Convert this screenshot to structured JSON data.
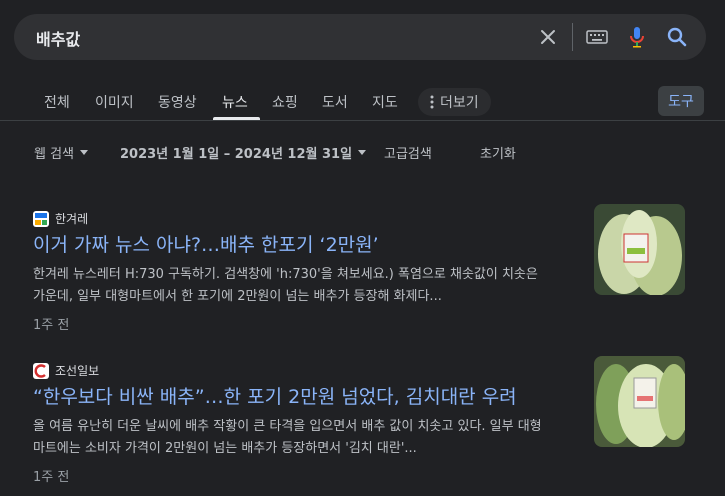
{
  "search": {
    "query": "배추값"
  },
  "icons": {
    "clear": "close-icon",
    "keyboard": "keyboard-icon",
    "mic": "mic-icon",
    "search": "search-icon"
  },
  "tabs": [
    {
      "label": "전체"
    },
    {
      "label": "이미지"
    },
    {
      "label": "동영상"
    },
    {
      "label": "뉴스",
      "active": true
    },
    {
      "label": "쇼핑"
    },
    {
      "label": "도서"
    },
    {
      "label": "지도"
    }
  ],
  "more_tab": {
    "label": "더보기"
  },
  "tools": {
    "label": "도구"
  },
  "filters": {
    "web_search": "웹 검색",
    "date_range": "2023년 1월 1일 – 2024년 12월 31일",
    "advanced": "고급검색",
    "reset": "초기화"
  },
  "results": [
    {
      "source": "한겨레",
      "title": "이거 가짜 뉴스 아냐?…배추 한포기 ‘2만원’",
      "snippet": "한겨레 뉴스레터 H:730 구독하기. 검색창에 'h:730'을 쳐보세요.) 폭염으로 채솟값이 치솟은 가운데, 일부 대형마트에서 한 포기에 2만원이 넘는 배추가 등장해 화제다...",
      "time": "1주 전"
    },
    {
      "source": "조선일보",
      "title": "“한우보다 비싼 배추”…한 포기 2만원 넘었다, 김치대란 우려",
      "snippet": "올 여름 유난히 더운 날씨에 배추 작황이 큰 타격을 입으면서 배추 값이 치솟고 있다. 일부 대형마트에는 소비자 가격이 2만원이 넘는 배추가 등장하면서 '김치 대란'...",
      "time": "1주 전"
    }
  ],
  "colors": {
    "background": "#202124",
    "link": "#8ab4f8",
    "text": "#bdc1c6"
  }
}
